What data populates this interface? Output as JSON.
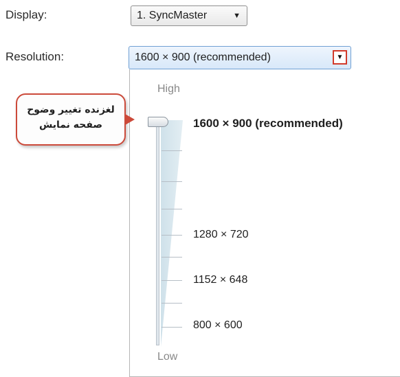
{
  "display": {
    "label": "Display:",
    "value": "1. SyncMaster",
    "arrow": "▼"
  },
  "resolution": {
    "label": "Resolution:",
    "value": "1600 × 900 (recommended)",
    "arrow": "▼",
    "high_label": "High",
    "low_label": "Low",
    "options": [
      {
        "text": "1600 × 900 (recommended)",
        "selected": true
      },
      {
        "text": "1280 × 720"
      },
      {
        "text": "1152 × 648"
      },
      {
        "text": "800 × 600"
      }
    ],
    "slider_position": "top"
  },
  "callout": {
    "line1": "لغزنده تغییر وضوح",
    "line2": "صفحه نمایش",
    "border_color": "#cc4a3a"
  }
}
